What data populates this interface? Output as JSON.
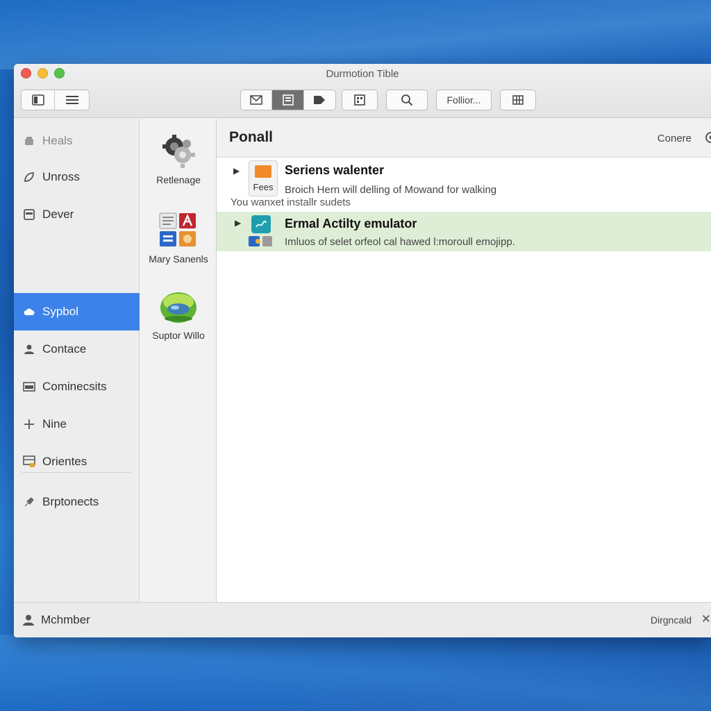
{
  "window": {
    "title": "Durmotion Tible"
  },
  "toolbar": {
    "folder_label": "Follior..."
  },
  "sidebar": {
    "items": [
      {
        "label": "Heals",
        "icon": "stack-icon"
      },
      {
        "label": "Unross",
        "icon": "leaf-icon"
      },
      {
        "label": "Dever",
        "icon": "drive-icon"
      },
      {
        "label": "Sypbol",
        "icon": "cloud-icon"
      },
      {
        "label": "Contace",
        "icon": "person-icon"
      },
      {
        "label": "Cominecsits",
        "icon": "window-icon"
      },
      {
        "label": "Nine",
        "icon": "plus-icon"
      },
      {
        "label": "Orientes",
        "icon": "grid-icon"
      },
      {
        "label": "Brptonects",
        "icon": "pin-icon"
      }
    ]
  },
  "apps": [
    {
      "label": "Retlenage",
      "icon": "gear-cluster-icon"
    },
    {
      "label": "Mary Sanenls",
      "icon": "office-apps-icon"
    },
    {
      "label": "Suptor Willo",
      "icon": "green-orb-icon"
    }
  ],
  "content": {
    "title": "Ponall",
    "action": "Conere",
    "rows": [
      {
        "title": "Seriens walenter",
        "subtitle": "Broich Hern will delling of Mowand for walking",
        "badge": "Fees"
      },
      {
        "title": "Ermal Actilty emulator",
        "subtitle": "Imluos of selet orfeol cal hawed l:moroull emojipp."
      }
    ],
    "note": "You wanxet installr sudets"
  },
  "status": {
    "user": "Mchmber",
    "right": "Dirgncald",
    "close": "✕"
  },
  "colors": {
    "selection": "#3d82e8",
    "highlight_row": "#deeed6",
    "desktop": "#1e6cc4"
  }
}
